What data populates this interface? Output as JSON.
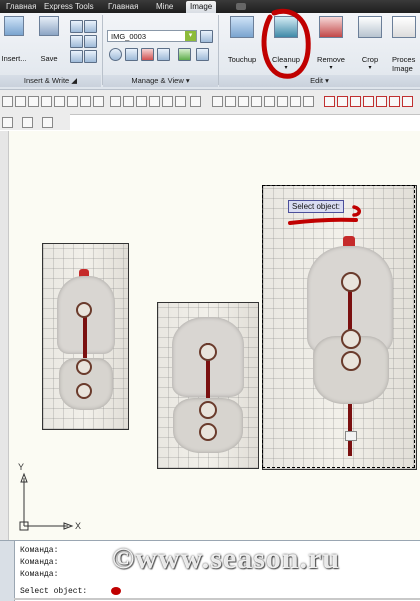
{
  "tabs": [
    {
      "label": "Главная"
    },
    {
      "label": "Express Tools"
    },
    {
      "label": "Главная"
    },
    {
      "label": "Mine"
    },
    {
      "label": "Image"
    }
  ],
  "ribbon": {
    "insert_label": "Insert...",
    "save_label": "Save",
    "image_name": "IMG_0003",
    "touchup_label": "Touchup",
    "cleanup_label": "Cleanup",
    "remove_label": "Remove",
    "crop_label": "Crop",
    "process_label_1": "Proces",
    "process_label_2": "Image",
    "panel_insert_write": "Insert & Write",
    "panel_manage_view": "Manage & View",
    "panel_edit": "Edit"
  },
  "canvas": {
    "tooltip": "Select object:",
    "axis_y": "Y",
    "axis_x": "X"
  },
  "command": {
    "lines": [
      "Команда:",
      "Команда:",
      "Команда:"
    ],
    "prompt": "Select object:"
  },
  "watermark": "©www.season.ru",
  "colors": {
    "annotation": "#c00000",
    "tab_bar": "#2a2a2a"
  }
}
